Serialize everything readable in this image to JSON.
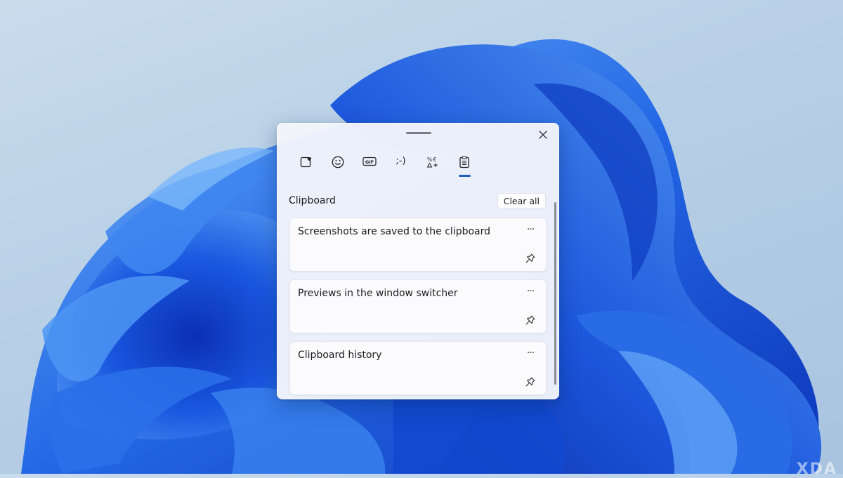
{
  "wallpaper": {
    "background_color": "#bcd3e8",
    "bloom_color": "#1f63e6"
  },
  "window": {
    "close_icon": "close-icon",
    "tabs": [
      {
        "name": "kaomoji-favorites",
        "icon": "heart-card-icon",
        "active": false
      },
      {
        "name": "emoji",
        "icon": "smiley-icon",
        "active": false
      },
      {
        "name": "gif",
        "icon": "gif-icon",
        "label": "GIF",
        "active": false
      },
      {
        "name": "kaomoji",
        "icon": "kaomoji-icon",
        "label": ";-)",
        "active": false
      },
      {
        "name": "symbols",
        "icon": "symbols-icon",
        "active": false
      },
      {
        "name": "clipboard",
        "icon": "clipboard-icon",
        "active": true
      }
    ],
    "accent": "#1f5fbf"
  },
  "clipboard": {
    "title": "Clipboard",
    "clear_label": "Clear all",
    "items": [
      {
        "text": "Screenshots are saved to the clipboard",
        "more_label": "···"
      },
      {
        "text": "Previews in the window switcher",
        "more_label": "···"
      },
      {
        "text": "Clipboard history",
        "more_label": "···"
      }
    ]
  },
  "watermark": "XDA"
}
